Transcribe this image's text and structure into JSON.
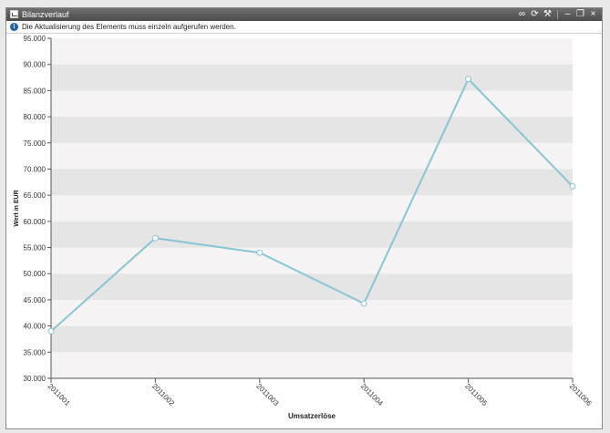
{
  "window": {
    "title": "Bilanzverlauf",
    "tools": {
      "export_icon": "link-icon",
      "refresh_icon": "refresh-icon",
      "settings_icon": "wrench-icon",
      "minimize_icon": "minimize-icon",
      "restore_icon": "restore-icon",
      "close_icon": "close-icon"
    }
  },
  "info": {
    "icon": "info-icon",
    "text": "Die Aktualisierung des Elements muss einzeln aufgerufen werden."
  },
  "colors": {
    "line": "#86c6d4",
    "band_dark": "#e5e5e5",
    "band_light": "#f5f3f3"
  },
  "chart_data": {
    "type": "line",
    "xlabel": "Umsatzerlöse",
    "ylabel": "Wert in EUR",
    "categories": [
      "2011001",
      "2011002",
      "2011003",
      "2011004",
      "2011005",
      "2011006"
    ],
    "series": [
      {
        "values": [
          39000,
          56800,
          54000,
          44300,
          87200,
          66700
        ]
      }
    ],
    "ylim": [
      30000,
      95000
    ],
    "yticks": [
      30000,
      35000,
      40000,
      45000,
      50000,
      55000,
      60000,
      65000,
      70000,
      75000,
      80000,
      85000,
      90000,
      95000
    ],
    "ytick_labels": [
      "30.000",
      "35.000",
      "40.000",
      "45.000",
      "50.000",
      "55.000",
      "60.000",
      "65.000",
      "70.000",
      "75.000",
      "80.000",
      "85.000",
      "90.000",
      "95.000"
    ],
    "grid": "alternating horizontal bands",
    "legend": "none"
  }
}
